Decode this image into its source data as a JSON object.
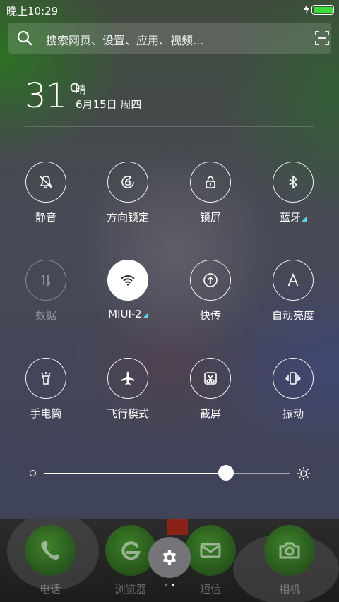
{
  "status_bar": {
    "time": "晚上10:29",
    "battery_level": 1.0
  },
  "search": {
    "placeholder": "搜索网页、设置、应用、视频..."
  },
  "weather": {
    "temperature": "31°",
    "condition": "晴",
    "date": "6月15日 周四"
  },
  "toggles": [
    {
      "label": "静音",
      "icon": "bell-off-icon",
      "state": "off"
    },
    {
      "label": "方向锁定",
      "icon": "rotation-lock-icon",
      "state": "off"
    },
    {
      "label": "锁屏",
      "icon": "lock-icon",
      "state": "off"
    },
    {
      "label": "蓝牙",
      "icon": "bluetooth-icon",
      "state": "off",
      "has_more": true
    },
    {
      "label": "数据",
      "icon": "mobile-data-icon",
      "state": "disabled"
    },
    {
      "label": "MIUI-2",
      "icon": "wifi-icon",
      "state": "on",
      "has_more": true
    },
    {
      "label": "快传",
      "icon": "quick-share-icon",
      "state": "off"
    },
    {
      "label": "自动亮度",
      "icon": "auto-brightness-icon",
      "state": "off"
    },
    {
      "label": "手电筒",
      "icon": "flashlight-icon",
      "state": "off"
    },
    {
      "label": "飞行模式",
      "icon": "airplane-icon",
      "state": "off"
    },
    {
      "label": "截屏",
      "icon": "screenshot-icon",
      "state": "off"
    },
    {
      "label": "振动",
      "icon": "vibrate-icon",
      "state": "off"
    }
  ],
  "brightness": {
    "level": 0.74
  },
  "dock": {
    "apps": [
      {
        "label": "电话",
        "icon": "phone-icon"
      },
      {
        "label": "浏览器",
        "icon": "browser-icon"
      },
      {
        "label": "短信",
        "icon": "messages-icon"
      },
      {
        "label": "相机",
        "icon": "camera-icon"
      }
    ],
    "settings_icon": "gear-icon",
    "page_count": 2,
    "current_page": 2
  },
  "colors": {
    "wifi_accent": "#5fd4e8",
    "battery": "#3ddc3d"
  }
}
